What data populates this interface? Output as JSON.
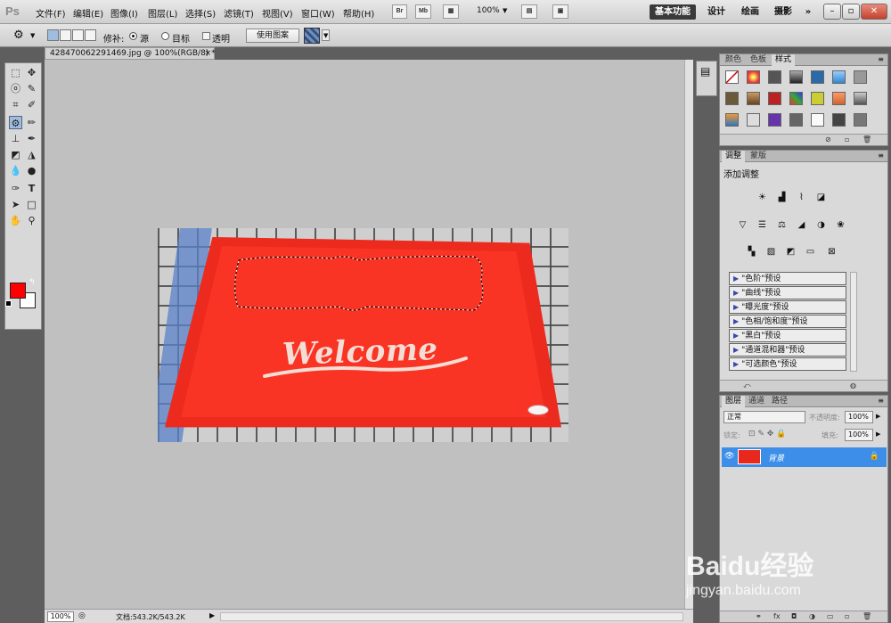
{
  "app": {
    "logo": "Ps"
  },
  "menu": [
    "文件(F)",
    "编辑(E)",
    "图像(I)",
    "图层(L)",
    "选择(S)",
    "滤镜(T)",
    "视图(V)",
    "窗口(W)",
    "帮助(H)"
  ],
  "appbar": {
    "br_label": "Br",
    "mb_label": "Mb",
    "zoom": "100%"
  },
  "workspaces": [
    "基本功能",
    "设计",
    "绘画",
    "摄影",
    "»"
  ],
  "options": {
    "patch_label": "修补:",
    "source_label": "源",
    "dest_label": "目标",
    "transparent_label": "透明",
    "use_pattern_label": "使用图案",
    "patch_mode": "源"
  },
  "document": {
    "tab_title": "428470062291469.jpg @ 100%(RGB/8) *",
    "image_text": "Welcome",
    "status_zoom": "100%",
    "status_doc": "文档:543.2K/543.2K",
    "foreground_color": "#ff0000",
    "background_color": "#ffffff"
  },
  "panels": {
    "styles_tabs": [
      "颜色",
      "色板",
      "样式"
    ],
    "styles_active": "样式",
    "adjust_tabs": [
      "调整",
      "蒙版"
    ],
    "adjust_active": "调整",
    "add_adjustment": "添加调整",
    "presets": [
      "\"色阶\"预设",
      "\"曲线\"预设",
      "\"曝光度\"预设",
      "\"色相/饱和度\"预设",
      "\"黑白\"预设",
      "\"通道混和器\"预设",
      "\"可选颜色\"预设"
    ],
    "layers_tabs": [
      "图层",
      "通道",
      "路径"
    ],
    "layers_active": "图层",
    "blend_mode": "正常",
    "opacity_label": "不透明度:",
    "opacity": "100%",
    "lock_label": "锁定:",
    "fill_label": "填充:",
    "fill": "100%",
    "layer_name": "背景"
  },
  "watermark": {
    "brand": "Baidu经验",
    "url": "jingyan.baidu.com"
  },
  "colors": {
    "accent": "#3d8ee8",
    "mat_red": "#fa3424"
  }
}
